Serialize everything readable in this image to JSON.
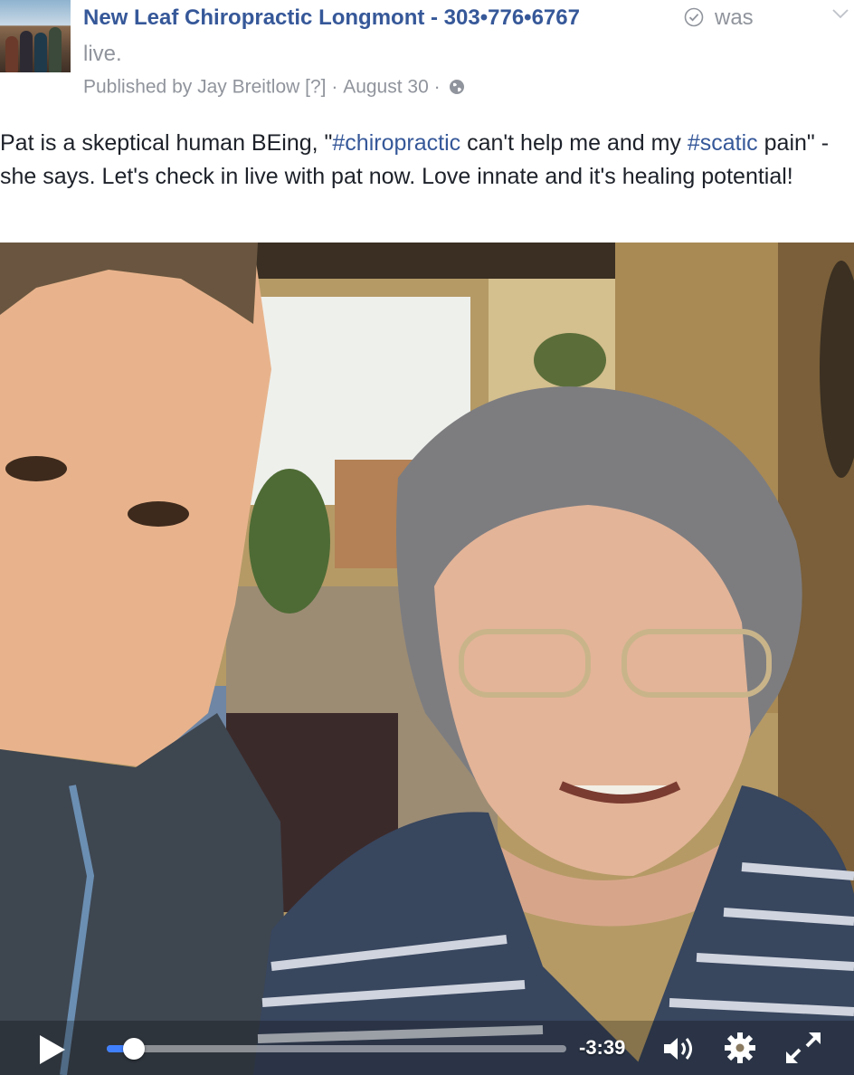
{
  "post": {
    "page_name": "New Leaf Chiropractic Longmont - 303•776•6767",
    "status": "was",
    "status_cont": "live.",
    "published_by": "Published by Jay Breitlow",
    "help": "[?]",
    "separator": "·",
    "date": "August 30",
    "separator2": "·"
  },
  "text": {
    "part1": "Pat is a skeptical human BEing, \"",
    "hashtag1": "#chiropractic",
    "part2": " can't help me and my ",
    "hashtag2": "#scatic",
    "part3": " pain\" - she says. Let's check in live with pat now. Love innate and it's healing potential!"
  },
  "video": {
    "time_remaining": "-3:39",
    "progress": 0.06
  },
  "icons": {
    "verified": "verified-check-icon",
    "chevron": "chevron-down-icon",
    "globe": "globe-icon",
    "play": "play-icon",
    "volume": "volume-icon",
    "settings": "gear-icon",
    "fullscreen": "fullscreen-icon"
  },
  "colors": {
    "link": "#365899",
    "muted": "#90949c",
    "text": "#1d2129",
    "progress": "#4080ff"
  }
}
